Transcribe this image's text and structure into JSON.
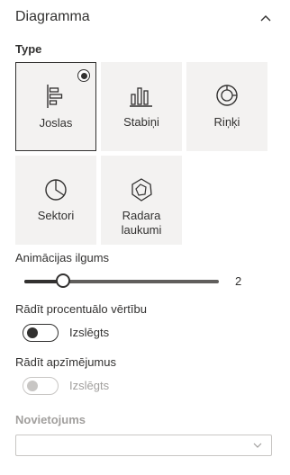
{
  "panel": {
    "title": "Diagramma",
    "collapse_icon": "chevron-up-icon"
  },
  "type_section": {
    "label": "Type",
    "tiles": [
      {
        "label": "Joslas",
        "icon": "bar-chart-horizontal-icon",
        "selected": true
      },
      {
        "label": "Stabiņi",
        "icon": "column-chart-icon",
        "selected": false
      },
      {
        "label": "Riņķi",
        "icon": "donut-chart-icon",
        "selected": false
      },
      {
        "label": "Sektori",
        "icon": "pie-chart-icon",
        "selected": false
      },
      {
        "label_line1": "Radara",
        "label_line2": "laukumi",
        "icon": "radar-chart-icon",
        "selected": false
      }
    ]
  },
  "animation": {
    "label": "Animācijas ilgums",
    "value": "2",
    "min": 0,
    "max": 10,
    "current": 2
  },
  "show_percent": {
    "label": "Rādīt procentuālo vērtību",
    "state_text": "Izslēgts",
    "on": false,
    "enabled": true
  },
  "show_labels": {
    "label": "Rādīt apzīmējumus",
    "state_text": "Izslēgts",
    "on": false,
    "enabled": false
  },
  "position": {
    "label": "Novietojums",
    "value": "",
    "enabled": false
  },
  "colors": {
    "text": "#323130",
    "tile_bg": "#f3f2f1",
    "disabled": "#a19f9d"
  }
}
